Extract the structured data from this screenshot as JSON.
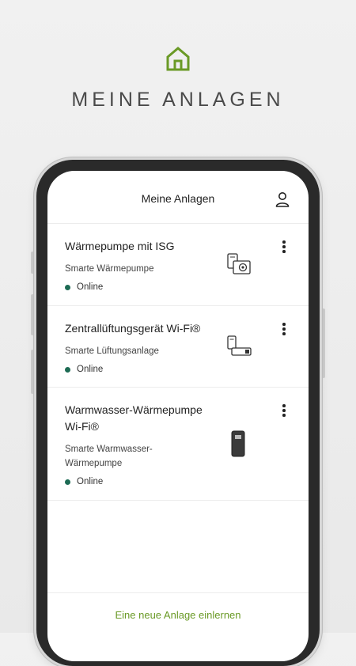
{
  "hero": {
    "title": "MEINE ANLAGEN",
    "icon": "house-icon"
  },
  "header": {
    "title": "Meine Anlagen",
    "icon": "user-icon"
  },
  "devices": [
    {
      "name": "Wärmepumpe mit ISG",
      "type": "Smarte Wärmepumpe",
      "status": "Online",
      "icon": "heatpump-isg-icon"
    },
    {
      "name": "Zentrallüftungsgerät Wi-Fi®",
      "type": "Smarte Lüftungsanlage",
      "status": "Online",
      "icon": "ventilation-unit-icon"
    },
    {
      "name": "Warmwasser-Wärmepumpe Wi-Fi®",
      "type": "Smarte Warmwasser-Wärmepumpe",
      "status": "Online",
      "icon": "water-heatpump-icon"
    }
  ],
  "footer": {
    "link": "Eine neue Anlage einlernen"
  },
  "colors": {
    "accent": "#6a9a26",
    "status_online": "#1d6b54"
  }
}
